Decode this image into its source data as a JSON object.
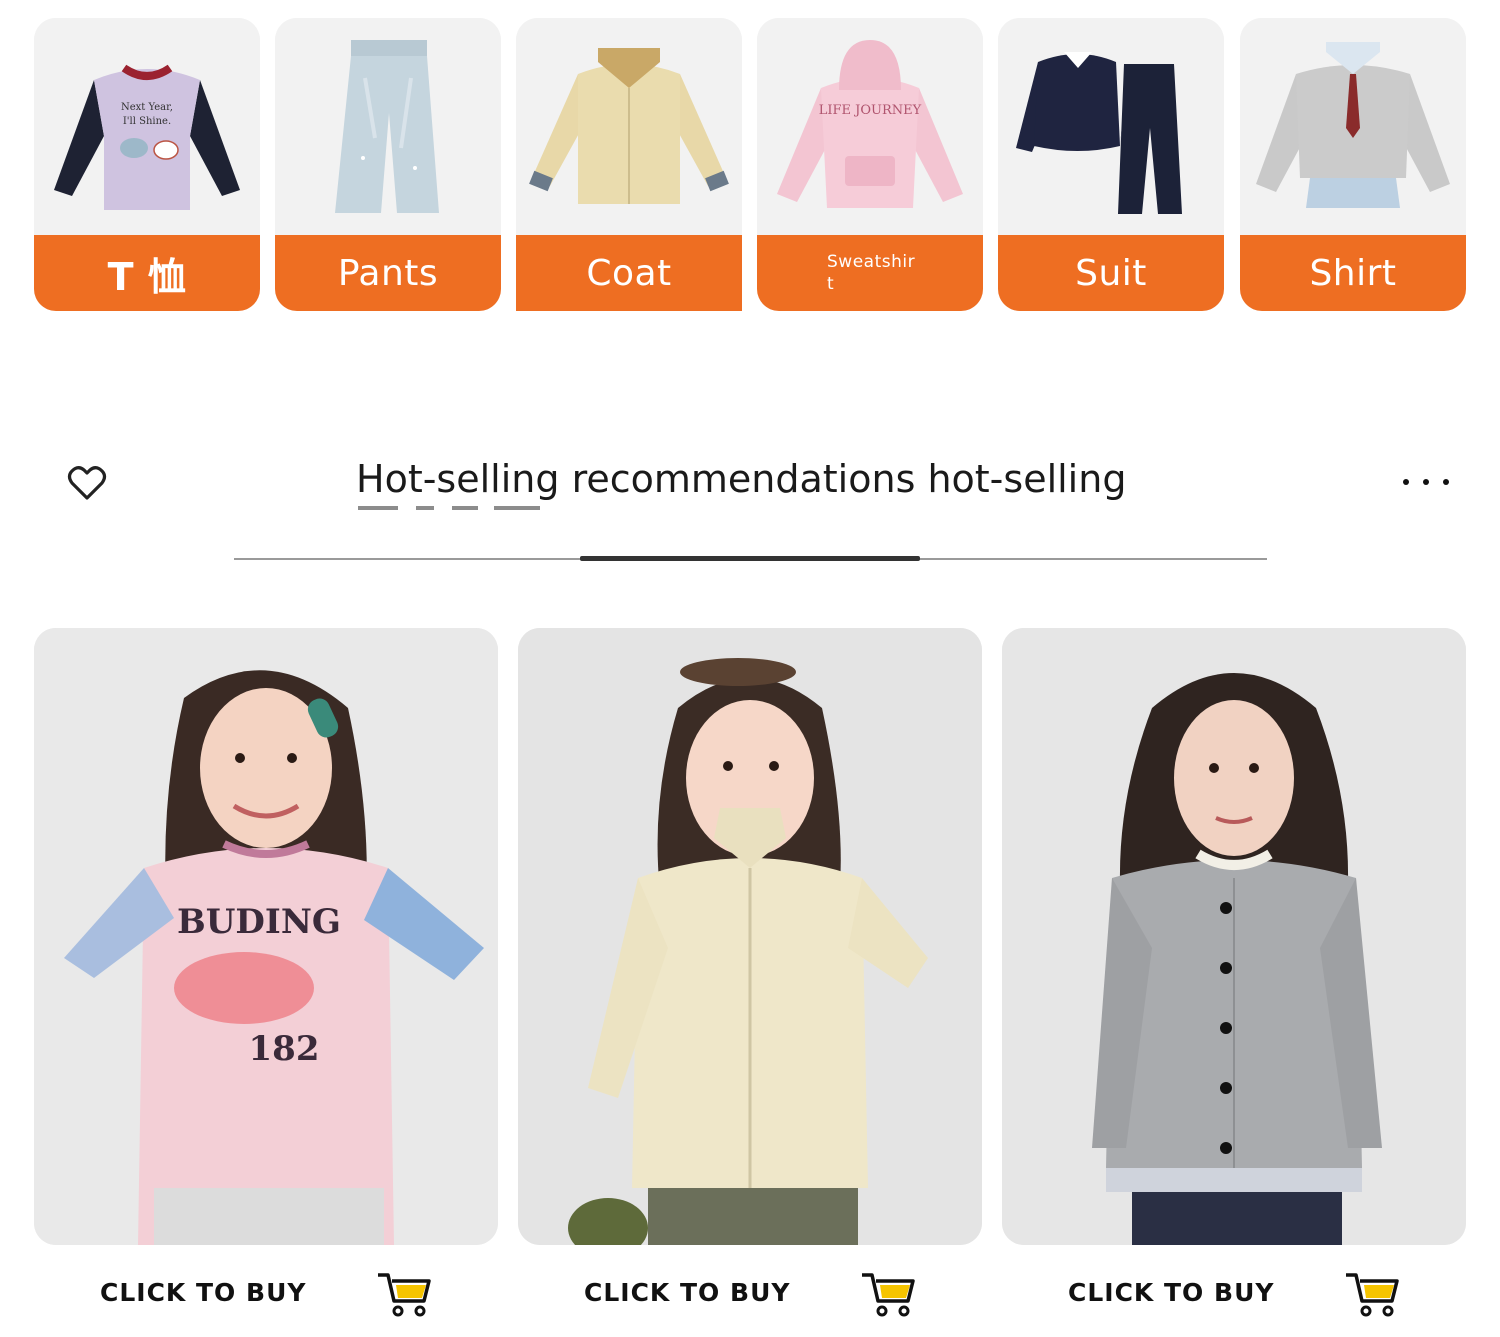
{
  "categories": [
    {
      "label": "T 恤",
      "image": "raglan-tshirt-image"
    },
    {
      "label": "Pants",
      "image": "wide-leg-jeans-image"
    },
    {
      "label": "Coat",
      "image": "beige-jacket-image"
    },
    {
      "label": "Sweatshirt",
      "image": "pink-hoodie-image"
    },
    {
      "label": "Suit",
      "image": "navy-two-piece-suit-image"
    },
    {
      "label": "Shirt",
      "image": "grey-sweater-shirt-image"
    }
  ],
  "section": {
    "title": "Hot-selling recommendations hot-selling",
    "heart_icon": "heart-outline-icon",
    "more_icon": "more-dots-icon"
  },
  "products": [
    {
      "cta": "CLICK TO BUY",
      "image": "girl-pink-raglan-sweatshirt-photo",
      "print_top": "BUDING",
      "print_bottom": "182"
    },
    {
      "cta": "CLICK TO BUY",
      "image": "girl-cream-hooded-jacket-photo"
    },
    {
      "cta": "CLICK TO BUY",
      "image": "girl-grey-button-cardigan-photo"
    }
  ],
  "colors": {
    "accent": "#ee6e22",
    "cart_accent": "#f5c400",
    "text": "#1a1a1a"
  }
}
